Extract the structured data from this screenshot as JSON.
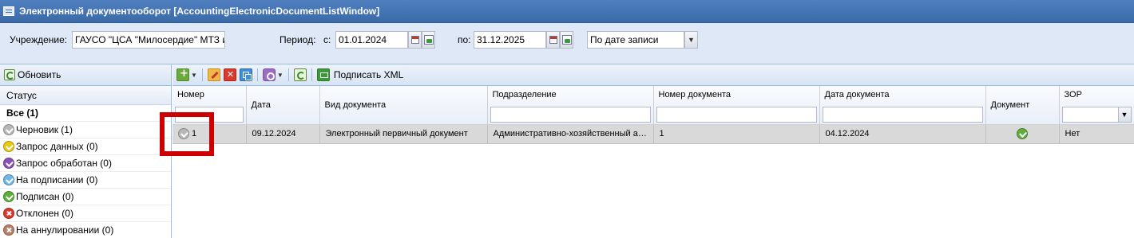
{
  "window": {
    "title": "Электронный документооборот [AccountingElectronicDocumentListWindow]"
  },
  "filters": {
    "institution_label": "Учреждение:",
    "institution_value": "ГАУСО \"ЦСА \"Милосердие\" МТЗ и",
    "period_label": "Период:",
    "from_label": "с:",
    "from_value": "01.01.2024",
    "to_label": "по:",
    "to_value": "31.12.2025",
    "date_mode_value": "По дате записи"
  },
  "left_panel": {
    "refresh_label": "Обновить",
    "header": "Статус",
    "all_item": "Все (1)",
    "statuses": [
      {
        "label": "Черновик (1)",
        "icon": "draft-status-icon",
        "color": "#b8b8b8"
      },
      {
        "label": "Запрос данных (0)",
        "icon": "data-request-status-icon",
        "color": "#e8c910"
      },
      {
        "label": "Запрос обработан (0)",
        "icon": "request-processed-status-icon",
        "color": "#8a4fb8"
      },
      {
        "label": "На подписании (0)",
        "icon": "signing-status-icon",
        "color": "#6fb7e8"
      },
      {
        "label": "Подписан (0)",
        "icon": "signed-status-icon",
        "color": "#5fae3c"
      },
      {
        "label": "Отклонен (0)",
        "icon": "rejected-status-icon",
        "color": "#d93a2b"
      },
      {
        "label": "На аннулировании (0)",
        "icon": "cancellation-status-icon",
        "color": "#b8806a"
      }
    ]
  },
  "toolbar": {
    "sign_xml_label": "Подписать XML"
  },
  "grid": {
    "columns": [
      "Номер",
      "Дата",
      "Вид документа",
      "Подразделение",
      "Номер документа",
      "Дата документа",
      "Документ",
      "ЗОР"
    ],
    "rows": [
      {
        "number": "1",
        "date": "09.12.2024",
        "doc_type": "Электронный первичный документ",
        "department": "Административно-хозяйственный ап...",
        "doc_number": "1",
        "doc_date": "04.12.2024",
        "zor": "Нет"
      }
    ]
  },
  "colors": {
    "title_bar": "#3b6aa8",
    "panel_bg": "#dfe8f6",
    "highlight": "#cc0000",
    "selected_row": "#d9d9d9"
  }
}
